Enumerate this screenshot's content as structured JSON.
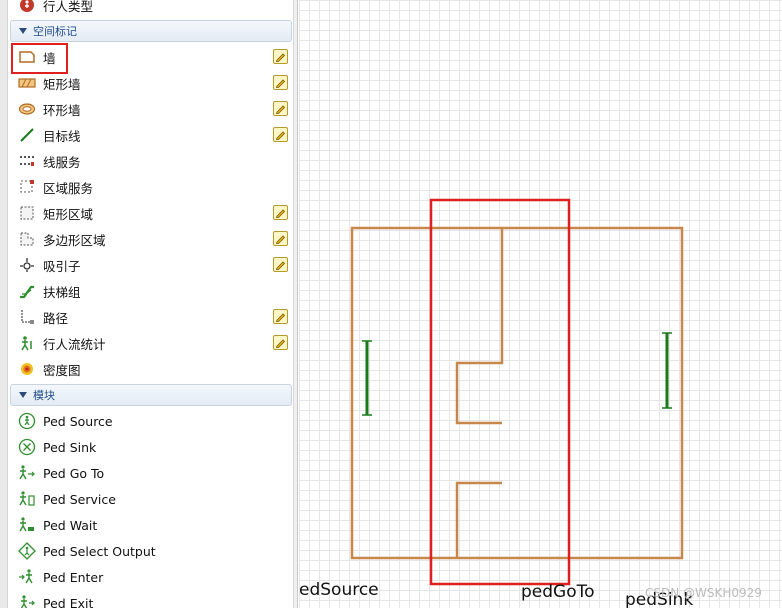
{
  "palette": {
    "top_item": {
      "label": "行人类型",
      "icon": "pedestrian-type-icon"
    },
    "sections": [
      {
        "title": "空间标记"
      },
      {
        "title": "模块"
      }
    ],
    "space_items": [
      {
        "label": "墙",
        "icon": "wall-icon",
        "editable": true
      },
      {
        "label": "矩形墙",
        "icon": "rect-wall-icon",
        "editable": true
      },
      {
        "label": "环形墙",
        "icon": "ring-wall-icon",
        "editable": true
      },
      {
        "label": "目标线",
        "icon": "target-line-icon",
        "editable": true
      },
      {
        "label": "线服务",
        "icon": "line-service-icon",
        "editable": false
      },
      {
        "label": "区域服务",
        "icon": "area-service-icon",
        "editable": false
      },
      {
        "label": "矩形区域",
        "icon": "rect-area-icon",
        "editable": true
      },
      {
        "label": "多边形区域",
        "icon": "polygon-area-icon",
        "editable": true
      },
      {
        "label": "吸引子",
        "icon": "attractor-icon",
        "editable": true
      },
      {
        "label": "扶梯组",
        "icon": "escalator-group-icon",
        "editable": false
      },
      {
        "label": "路径",
        "icon": "path-icon",
        "editable": true
      },
      {
        "label": "行人流统计",
        "icon": "ped-flow-stats-icon",
        "editable": true
      },
      {
        "label": "密度图",
        "icon": "density-map-icon",
        "editable": false
      }
    ],
    "module_items": [
      {
        "label": "Ped Source",
        "icon": "ped-source-icon"
      },
      {
        "label": "Ped Sink",
        "icon": "ped-sink-icon"
      },
      {
        "label": "Ped Go To",
        "icon": "ped-goto-icon"
      },
      {
        "label": "Ped Service",
        "icon": "ped-service-icon"
      },
      {
        "label": "Ped Wait",
        "icon": "ped-wait-icon"
      },
      {
        "label": "Ped Select Output",
        "icon": "ped-select-output-icon"
      },
      {
        "label": "Ped Enter",
        "icon": "ped-enter-icon"
      },
      {
        "label": "Ped Exit",
        "icon": "ped-exit-icon"
      }
    ]
  },
  "canvas": {
    "labels": {
      "ped_source": "edSource",
      "ped_goto": "pedGoTo",
      "ped_sink": "pedSink"
    },
    "watermark": "CSDN @WSKH0929",
    "colors": {
      "wall": "#c8874a",
      "target_line": "#1a7a1a",
      "annotation": "#e02020"
    }
  }
}
